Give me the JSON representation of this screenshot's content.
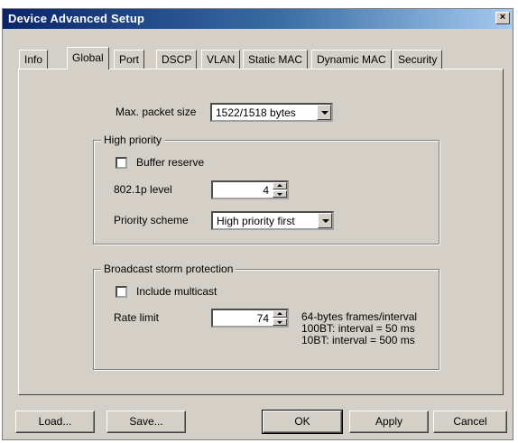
{
  "window": {
    "title": "Device Advanced Setup",
    "close_label": "×"
  },
  "tabs": [
    "Info",
    "Global",
    "Port",
    "DSCP",
    "VLAN",
    "Static MAC",
    "Dynamic MAC",
    "Security"
  ],
  "global": {
    "max_packet_label": "Max. packet size",
    "max_packet_value": "1522/1518 bytes",
    "high_priority": {
      "title": "High priority",
      "buffer_reserve_label": "Buffer reserve",
      "buffer_reserve_checked": false,
      "level_label": "802.1p level",
      "level_value": "4",
      "scheme_label": "Priority scheme",
      "scheme_value": "High priority first"
    },
    "broadcast": {
      "title": "Broadcast storm protection",
      "include_multicast_label": "Include multicast",
      "include_multicast_checked": false,
      "rate_label": "Rate limit",
      "rate_value": "74",
      "rate_note_1": "64-bytes frames/interval",
      "rate_note_2": "100BT: interval = 50 ms",
      "rate_note_3": "10BT: interval = 500 ms"
    }
  },
  "buttons": {
    "load": "Load...",
    "save": "Save...",
    "ok": "OK",
    "apply": "Apply",
    "cancel": "Cancel"
  }
}
